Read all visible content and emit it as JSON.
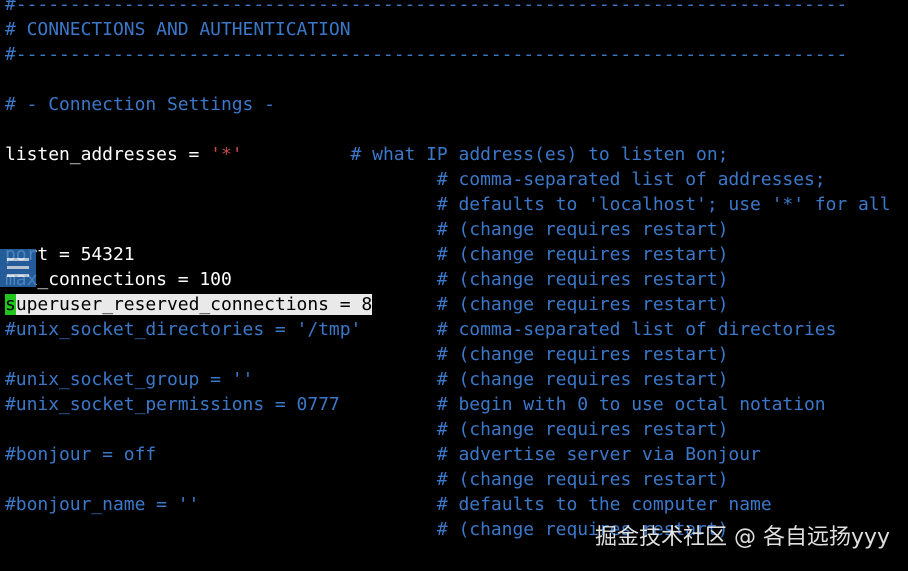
{
  "terminal": {
    "colors": {
      "background": "#000000",
      "comment": "#3b78c9",
      "text": "#ffffff",
      "string": "#c44a4a",
      "selection": "#e9e9e9",
      "cursor": "#22c41e"
    },
    "lines": [
      {
        "segments": [
          {
            "t": "#-----------------------------------------------------------------------------",
            "s": "c"
          }
        ]
      },
      {
        "segments": [
          {
            "t": "# CONNECTIONS AND AUTHENTICATION",
            "s": "c"
          }
        ]
      },
      {
        "segments": [
          {
            "t": "#-----------------------------------------------------------------------------",
            "s": "c"
          }
        ]
      },
      {
        "segments": []
      },
      {
        "segments": [
          {
            "t": "# - Connection Settings -",
            "s": "c"
          }
        ]
      },
      {
        "segments": []
      },
      {
        "segments": [
          {
            "t": "listen_addresses = ",
            "s": "w"
          },
          {
            "t": "'*'",
            "s": "r"
          },
          {
            "t": "          ",
            "s": "w"
          },
          {
            "t": "# what IP address(es) to listen on;",
            "s": "c"
          }
        ]
      },
      {
        "segments": [
          {
            "t": "                                        ",
            "s": "w"
          },
          {
            "t": "# comma-separated list of addresses;",
            "s": "c"
          }
        ]
      },
      {
        "segments": [
          {
            "t": "                                        ",
            "s": "w"
          },
          {
            "t": "# defaults to 'localhost'; use '*' for all",
            "s": "c"
          }
        ]
      },
      {
        "segments": [
          {
            "t": "                                        ",
            "s": "w"
          },
          {
            "t": "# (change requires restart)",
            "s": "c"
          }
        ]
      },
      {
        "segments": [
          {
            "t": "port = 54321",
            "s": "w"
          },
          {
            "t": "                            ",
            "s": "w"
          },
          {
            "t": "# (change requires restart)",
            "s": "c"
          }
        ]
      },
      {
        "segments": [
          {
            "t": "max_connections = 100",
            "s": "w"
          },
          {
            "t": "                   ",
            "s": "w"
          },
          {
            "t": "# (change requires restart)",
            "s": "c"
          }
        ]
      },
      {
        "segments": [
          {
            "t": "s",
            "s": "cursor"
          },
          {
            "t": "uperuser_reserved_connections = 8",
            "s": "sel"
          },
          {
            "t": "      ",
            "s": "w"
          },
          {
            "t": "# (change requires restart)",
            "s": "c"
          }
        ]
      },
      {
        "segments": [
          {
            "t": "#unix_socket_directories = '/tmp'",
            "s": "c"
          },
          {
            "t": "       ",
            "s": "w"
          },
          {
            "t": "# comma-separated list of directories",
            "s": "c"
          }
        ]
      },
      {
        "segments": [
          {
            "t": "                                        ",
            "s": "w"
          },
          {
            "t": "# (change requires restart)",
            "s": "c"
          }
        ]
      },
      {
        "segments": [
          {
            "t": "#unix_socket_group = ''",
            "s": "c"
          },
          {
            "t": "                 ",
            "s": "w"
          },
          {
            "t": "# (change requires restart)",
            "s": "c"
          }
        ]
      },
      {
        "segments": [
          {
            "t": "#unix_socket_permissions = 0777",
            "s": "c"
          },
          {
            "t": "         ",
            "s": "w"
          },
          {
            "t": "# begin with 0 to use octal notation",
            "s": "c"
          }
        ]
      },
      {
        "segments": [
          {
            "t": "                                        ",
            "s": "w"
          },
          {
            "t": "# (change requires restart)",
            "s": "c"
          }
        ]
      },
      {
        "segments": [
          {
            "t": "#bonjour = off",
            "s": "c"
          },
          {
            "t": "                          ",
            "s": "w"
          },
          {
            "t": "# advertise server via Bonjour",
            "s": "c"
          }
        ]
      },
      {
        "segments": [
          {
            "t": "                                        ",
            "s": "w"
          },
          {
            "t": "# (change requires restart)",
            "s": "c"
          }
        ]
      },
      {
        "segments": [
          {
            "t": "#bonjour_name = ''",
            "s": "c"
          },
          {
            "t": "                      ",
            "s": "w"
          },
          {
            "t": "# defaults to the computer name",
            "s": "c"
          }
        ]
      },
      {
        "segments": [
          {
            "t": "                                        ",
            "s": "w"
          },
          {
            "t": "# (change requires restart)",
            "s": "c"
          }
        ]
      }
    ]
  },
  "overlay": {
    "icon": "list-menu-icon",
    "color": "#2a6db3"
  },
  "watermark": {
    "text": "掘金技术社区 @ 各自远扬yyy"
  }
}
